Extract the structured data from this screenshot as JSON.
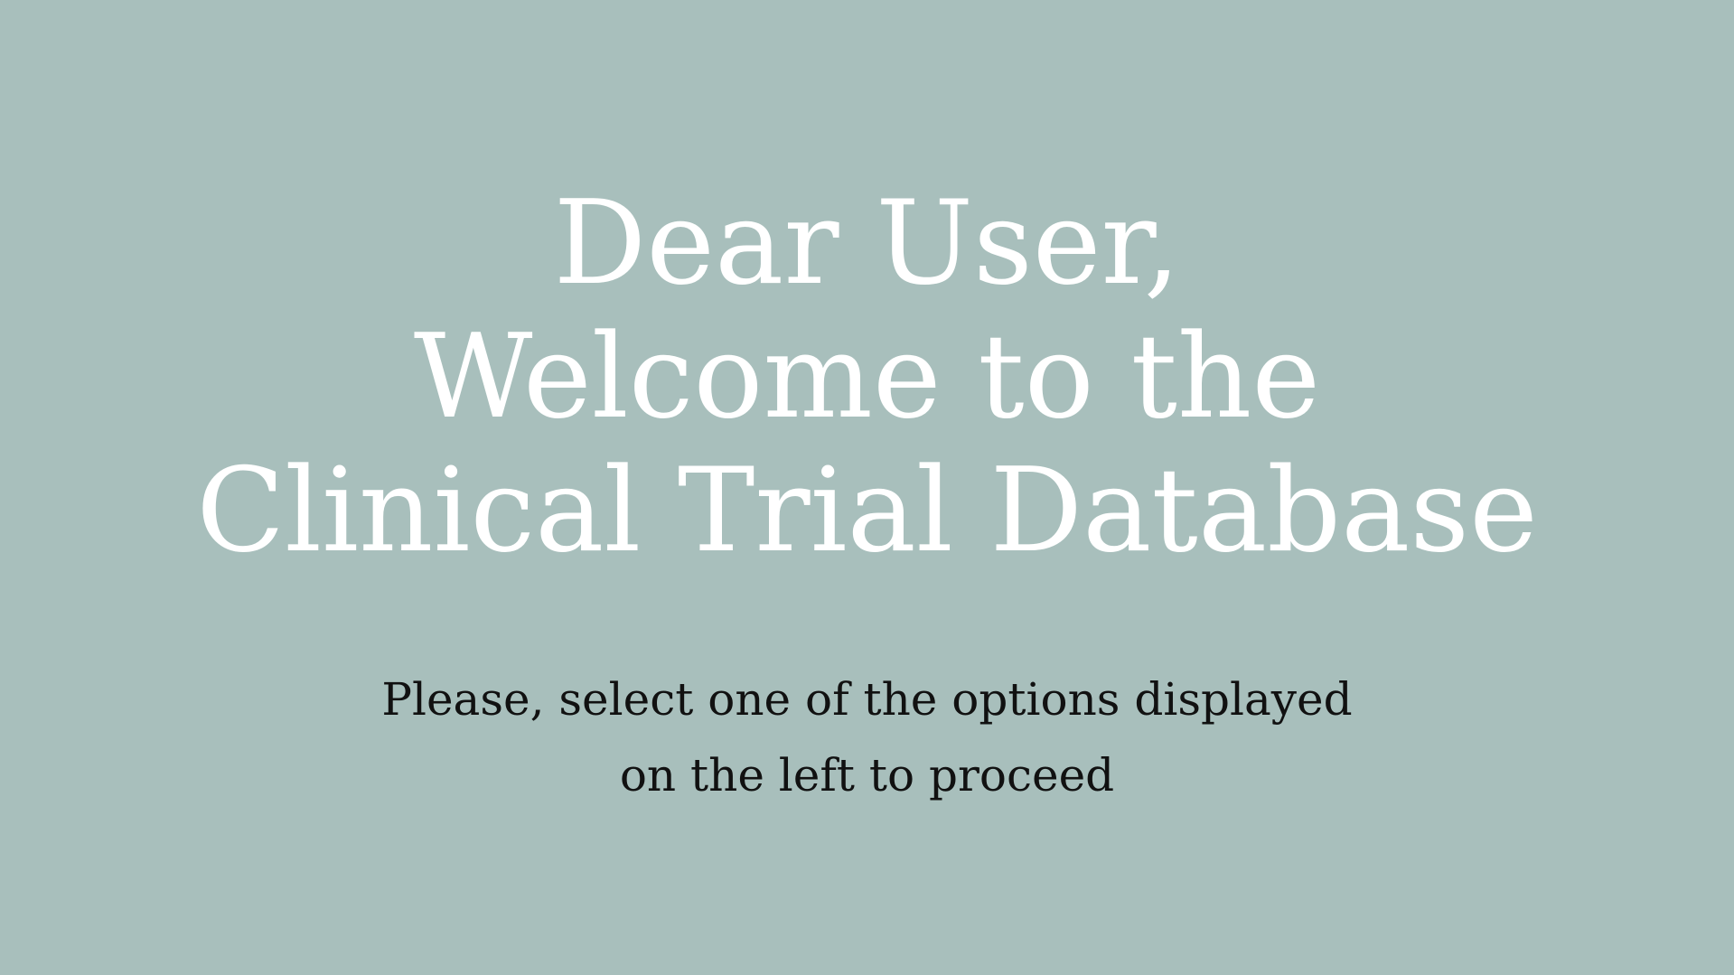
{
  "welcome": {
    "title_lines": [
      "Dear User,",
      "Welcome to the",
      "Clinical Trial Database"
    ],
    "instruction_lines": [
      "Please, select one of the options displayed",
      "on the left to proceed"
    ]
  },
  "colors": {
    "background": "#a8bfbc",
    "title": "#ffffff",
    "instruction": "#111111"
  }
}
